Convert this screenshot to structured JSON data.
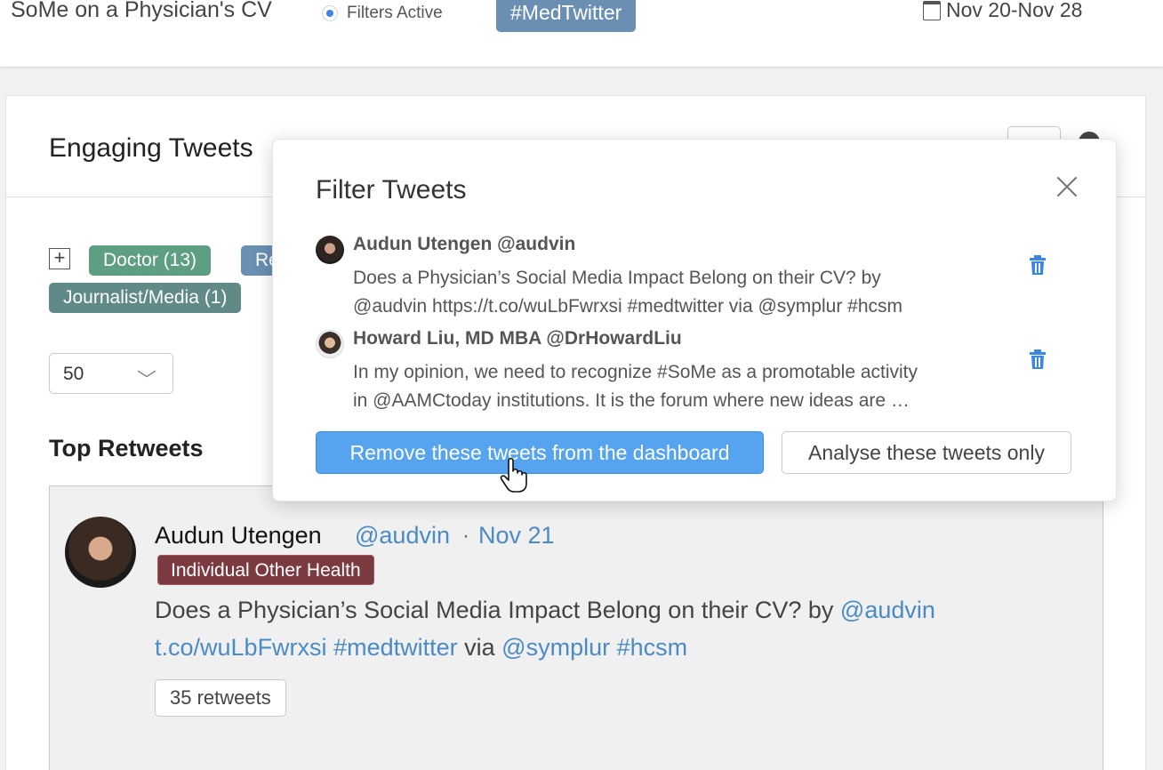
{
  "header": {
    "app_title": "SoMe on a Physician's CV",
    "filters_label": "Filters Active",
    "hashtag": "#MedTwitter",
    "date_range": "Nov 20-Nov 28"
  },
  "card": {
    "title": "Engaging Tweets",
    "tags": {
      "doctor": "Doctor (13)",
      "research_partial": "Re",
      "journalist": "Journalist/Media (1)"
    },
    "limit_value": "50",
    "section_title": "Top Retweets"
  },
  "top_retweet": {
    "name": "Audun Utengen",
    "handle": "@audvin",
    "separator": "·",
    "date": "Nov 21",
    "badge": "Individual Other Health",
    "text_start": "Does a Physician’s Social Media Impact Belong on their CV? by ",
    "mention_1": "@audvin",
    "link": "t.co/wuLbFwrxsi",
    "hashtag_1": "#medtwitter",
    "via": " via ",
    "mention_2": "@symplur",
    "hashtag_2": "#hcsm",
    "retweets": "35 retweets"
  },
  "popup": {
    "title": "Filter Tweets",
    "tweets": [
      {
        "author": "Audun Utengen @audvin",
        "text": "Does a Physician’s Social Media Impact Belong on their CV? by\n@audvin https://t.co/wuLbFwrxsi #medtwitter via @symplur #hcsm"
      },
      {
        "author": "Howard Liu, MD MBA @DrHowardLiu",
        "text": "In my opinion, we need to recognize #SoMe as a promotable activity\nin @AAMCtoday institutions. It is the forum where new ideas are …"
      }
    ],
    "remove_button": "Remove these tweets from the dashboard",
    "analyse_button": "Analyse these tweets only"
  },
  "colors": {
    "accent_blue": "#56a4ef",
    "link_blue": "#4a8bc6",
    "hashtag_pill": "#6a8fb3",
    "tag_doctor": "#5e9f84",
    "tag_journalist": "#5f8a88",
    "badge_health": "#7b3a40"
  },
  "icons": [
    "calendar-icon",
    "gear-icon",
    "plus-icon",
    "chevron-down-icon",
    "close-icon",
    "trash-icon",
    "hand-cursor-icon"
  ]
}
